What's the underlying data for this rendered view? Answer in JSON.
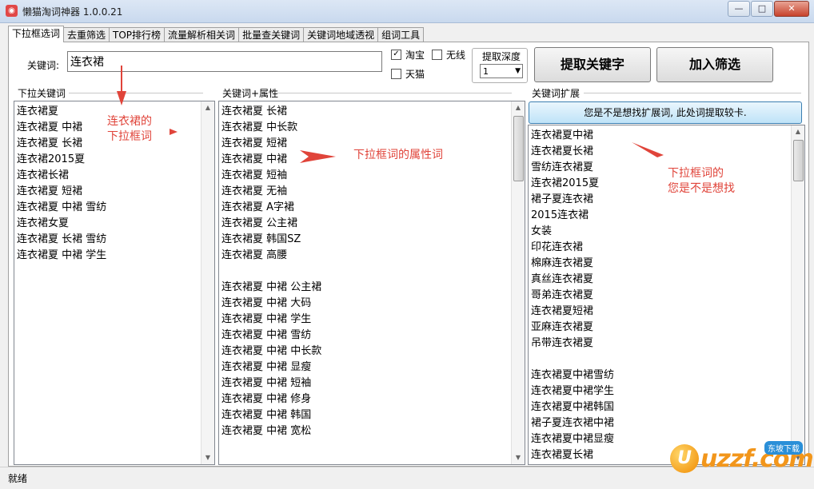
{
  "window": {
    "title": "懒猫淘词神器 1.0.0.21",
    "icon": "cat-logo-icon"
  },
  "tabs": [
    "下拉框选词",
    "去重筛选",
    "TOP排行榜",
    "流量解析相关词",
    "批量查关键词",
    "关键词地域透视",
    "组词工具"
  ],
  "form": {
    "keyword_label": "关键词:",
    "keyword_value": "连衣裙",
    "taobao": {
      "label": "淘宝",
      "checked": true
    },
    "wuxian": {
      "label": "无线",
      "checked": false
    },
    "tmall": {
      "label": "天猫",
      "checked": false
    },
    "depth_label": "提取深度",
    "depth_value": "1",
    "extract_button": "提取关键字",
    "filter_button": "加入筛选"
  },
  "left": {
    "header": "下拉关键词",
    "items": [
      "连衣裙夏",
      "连衣裙夏 中裙",
      "连衣裙夏 长裙",
      "连衣裙2015夏",
      "连衣裙长裙",
      "连衣裙夏 短裙",
      "连衣裙夏 中裙 雪纺",
      "连衣裙女夏",
      "连衣裙夏 长裙 雪纺",
      "连衣裙夏 中裙 学生"
    ]
  },
  "middle": {
    "header": "关键词+属性",
    "items": [
      "连衣裙夏 长裙",
      "连衣裙夏 中长款",
      "连衣裙夏 短裙",
      "连衣裙夏 中裙",
      "连衣裙夏 短袖",
      "连衣裙夏 无袖",
      "连衣裙夏 A字裙",
      "连衣裙夏 公主裙",
      "连衣裙夏 韩国SZ",
      "连衣裙夏 高腰",
      "",
      "连衣裙夏 中裙 公主裙",
      "连衣裙夏 中裙 大码",
      "连衣裙夏 中裙 学生",
      "连衣裙夏 中裙 雪纺",
      "连衣裙夏 中裙 中长款",
      "连衣裙夏 中裙 显瘦",
      "连衣裙夏 中裙 短袖",
      "连衣裙夏 中裙 修身",
      "连衣裙夏 中裙 韩国",
      "连衣裙夏 中裙 宽松"
    ]
  },
  "right": {
    "header": "关键词扩展",
    "suggest_button": "您是不是想找扩展词, 此处词提取较卡.",
    "items": [
      "连衣裙夏中裙",
      "连衣裙夏长裙",
      "雪纺连衣裙夏",
      "连衣裙2015夏",
      "裙子夏连衣裙",
      "2015连衣裙",
      "女装",
      "印花连衣裙",
      "棉麻连衣裙夏",
      "真丝连衣裙夏",
      "哥弟连衣裙夏",
      "连衣裙夏短裙",
      "亚麻连衣裙夏",
      "吊带连衣裙夏",
      "",
      "连衣裙夏中裙雪纺",
      "连衣裙夏中裙学生",
      "连衣裙夏中裙韩国",
      "裙子夏连衣裙中裙",
      "连衣裙夏中裙显瘦",
      "连衣裙夏长裙"
    ]
  },
  "annotations": {
    "left_line1": "连衣裙的",
    "left_line2": "下拉框词",
    "middle": "下拉框词的属性词",
    "right_line1": "下拉框词的",
    "right_line2": "您是不是想找"
  },
  "status": "就绪",
  "watermark": {
    "text": "uzzf.com",
    "badge": "东坡下载",
    "accent": "#f2961b"
  },
  "colors": {
    "annotation": "#e0443a",
    "suggest_border": "#3c7fb1"
  }
}
